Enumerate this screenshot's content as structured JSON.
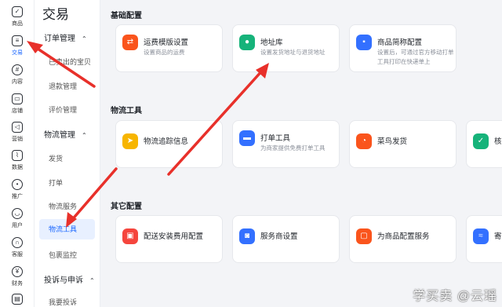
{
  "rail": {
    "items": [
      {
        "label": "商品",
        "icon": "tag-icon"
      },
      {
        "label": "交易",
        "icon": "order-list-icon"
      },
      {
        "label": "内容",
        "icon": "hash-icon"
      },
      {
        "label": "店铺",
        "icon": "store-icon"
      },
      {
        "label": "营销",
        "icon": "megaphone-icon"
      },
      {
        "label": "数据",
        "icon": "chart-icon"
      },
      {
        "label": "推广",
        "icon": "location-icon"
      },
      {
        "label": "用户",
        "icon": "user-icon"
      },
      {
        "label": "客服",
        "icon": "headset-icon"
      },
      {
        "label": "财务",
        "icon": "yuan-icon"
      }
    ]
  },
  "menu": {
    "title": "交易",
    "groups": [
      {
        "label": "订单管理",
        "items": [
          "已卖出的宝贝",
          "退款管理",
          "评价管理"
        ]
      },
      {
        "label": "物流管理",
        "items": [
          "发货",
          "打单",
          "物流服务",
          "物流工具",
          "包裹监控"
        ]
      },
      {
        "label": "投诉与申诉",
        "items": [
          "我要投诉"
        ]
      }
    ],
    "active_item": "物流工具"
  },
  "sections": [
    {
      "title": "基础配置",
      "cards": [
        {
          "title": "运费模版设置",
          "desc": "设置商品的运费",
          "color": "#fa541c",
          "icon": "shipping-template-icon"
        },
        {
          "title": "地址库",
          "desc": "设置发货地址与退货地址",
          "color": "#16b37a",
          "icon": "map-pin-icon"
        },
        {
          "title": "商品简称配置",
          "desc": "设置后，可通过官方移动打单工具打印在快递单上",
          "color": "#3370ff",
          "icon": "product-tag-icon"
        }
      ]
    },
    {
      "title": "物流工具",
      "cards": [
        {
          "title": "物流追踪信息",
          "desc": "",
          "color": "#f7b500",
          "icon": "send-icon"
        },
        {
          "title": "打单工具",
          "desc": "为商家提供免费打单工具",
          "color": "#3370ff",
          "icon": "printer-icon"
        },
        {
          "title": "菜鸟发货",
          "desc": "",
          "color": "#fa541c",
          "icon": "cainiao-icon"
        },
        {
          "title": "核",
          "desc": "",
          "color": "#16b37a",
          "icon": "verify-icon"
        }
      ]
    },
    {
      "title": "其它配置",
      "cards": [
        {
          "title": "配送安装费用配置",
          "desc": "",
          "color": "#f5453d",
          "icon": "install-fee-icon"
        },
        {
          "title": "服务商设置",
          "desc": "",
          "color": "#3370ff",
          "icon": "provider-icon"
        },
        {
          "title": "为商品配置服务",
          "desc": "",
          "color": "#fa541c",
          "icon": "service-icon"
        },
        {
          "title": "寄",
          "desc": "",
          "color": "#3370ff",
          "icon": "mail-icon"
        }
      ]
    }
  ],
  "watermark": "学买卖 @云瑶",
  "colors": {
    "accent": "#1966ff",
    "arrow": "#e8302a"
  }
}
